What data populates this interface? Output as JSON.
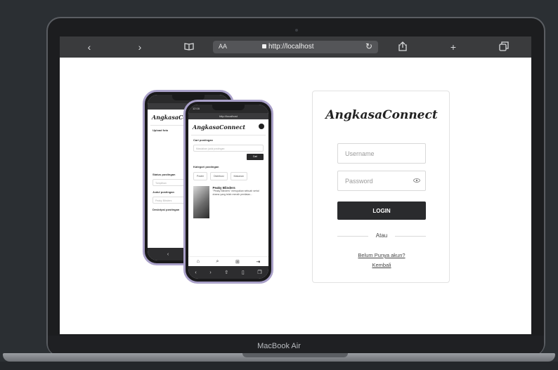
{
  "device": {
    "model_label": "MacBook Air"
  },
  "browser": {
    "back_icon": "chevron-left-icon",
    "forward_icon": "chevron-right-icon",
    "bookmarks_icon": "book-icon",
    "text_size_label": "AA",
    "url": "http://localhost",
    "reload_icon": "reload-icon",
    "share_icon": "share-icon",
    "new_tab_icon": "plus-icon",
    "tabs_icon": "tabs-icon"
  },
  "login": {
    "brand": "AngkasaConnect",
    "username_placeholder": "Username",
    "password_placeholder": "Password",
    "login_label": "LOGIN",
    "divider_text": "Atau",
    "signup_link": "Belum Punya akun?",
    "back_link": "Kembali"
  },
  "phone_back": {
    "brand": "AngkasaConnect",
    "upload_label": "Upload foto",
    "status_label": "Status postingan",
    "status_value": "Tampilkan",
    "title_label": "Judul postingan",
    "title_value": "Peaky Blinders",
    "desc_label": "Deskripsi postingan"
  },
  "phone_front": {
    "time": "12:16",
    "url": "http://localhost",
    "brand": "AngkasaConnect",
    "search_label": "Cari postingan",
    "search_placeholder": "Masukkan judul postingan",
    "search_button": "Cari",
    "category_label": "Kategori postingan",
    "categories": [
      "Poster",
      "Distribusi",
      "Makanan"
    ],
    "post_title": "Peaky Blinders",
    "post_text": "\"Peaky Blinders\" merupakan sebuah serial drama yang telah meraih penilaian..."
  }
}
